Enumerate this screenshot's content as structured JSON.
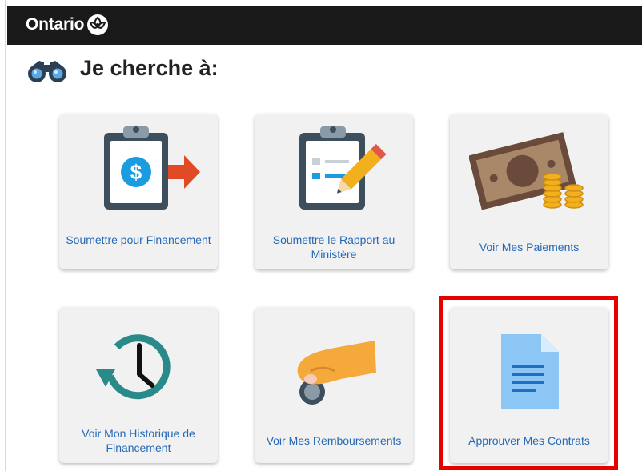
{
  "header": {
    "brand": "Ontario"
  },
  "page": {
    "heading": "Je cherche à:"
  },
  "tiles": [
    {
      "label": "Soumettre pour Financement",
      "icon": "clipboard-dollar-icon"
    },
    {
      "label": "Soumettre le Rapport au Ministère",
      "icon": "clipboard-pencil-icon"
    },
    {
      "label": "Voir Mes Paiements",
      "icon": "money-coins-icon"
    },
    {
      "label": "Voir Mon Historique de Financement",
      "icon": "history-clock-icon"
    },
    {
      "label": "Voir Mes Remboursements",
      "icon": "hand-coin-icon"
    },
    {
      "label": "Approuver Mes Contrats",
      "icon": "document-icon"
    }
  ],
  "colors": {
    "header_bg": "#1a1a1a",
    "link": "#2468b8",
    "highlight": "#e60000",
    "tile_bg": "#f1f1f1"
  }
}
